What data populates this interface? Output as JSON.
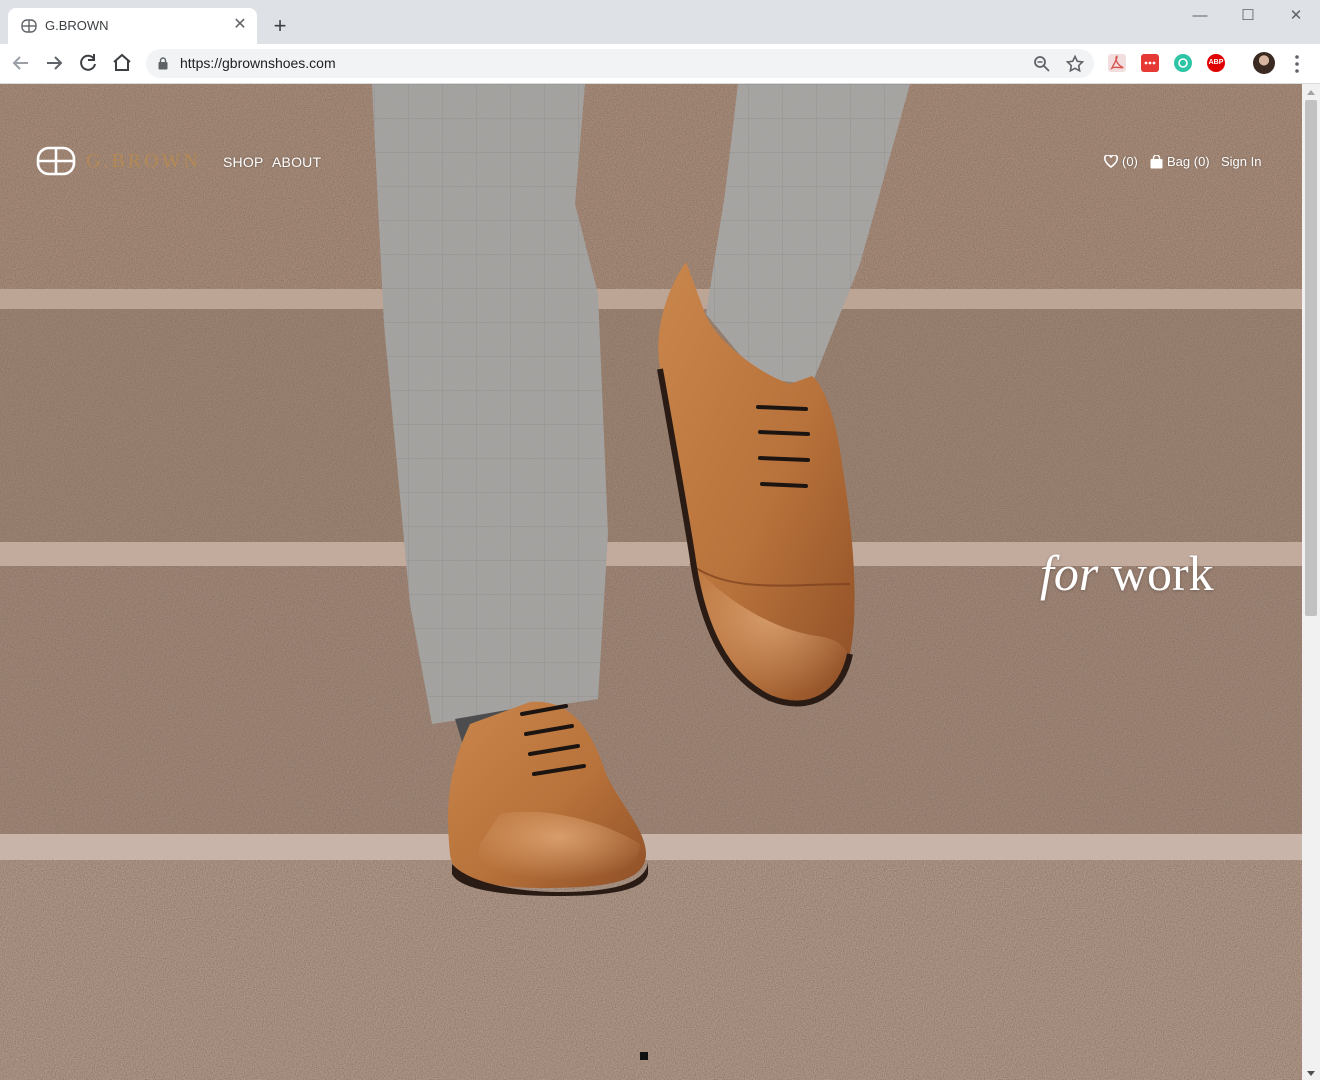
{
  "browser": {
    "tab_title": "G.BROWN",
    "url": "https://gbrownshoes.com",
    "window_controls": [
      "minimize-icon",
      "maximize-icon",
      "close-icon"
    ],
    "extensions": [
      {
        "name": "pdf-extension-icon",
        "color": "#d9534f"
      },
      {
        "name": "ellipsis-extension-icon",
        "color": "#e53935"
      },
      {
        "name": "green-circle-extension-icon",
        "color": "#2ec4a5"
      },
      {
        "name": "abp-extension-icon",
        "label": "ABP",
        "color": "#e00000"
      }
    ]
  },
  "site": {
    "brand": "G.BROWN",
    "nav": {
      "shop": "SHOP",
      "about": "ABOUT"
    },
    "wishlist_count": "(0)",
    "bag": "Bag (0)",
    "sign_in": "Sign In",
    "accent_color": "#b58a52"
  },
  "hero": {
    "tagline_italic": "for",
    "tagline_rest": " work"
  }
}
